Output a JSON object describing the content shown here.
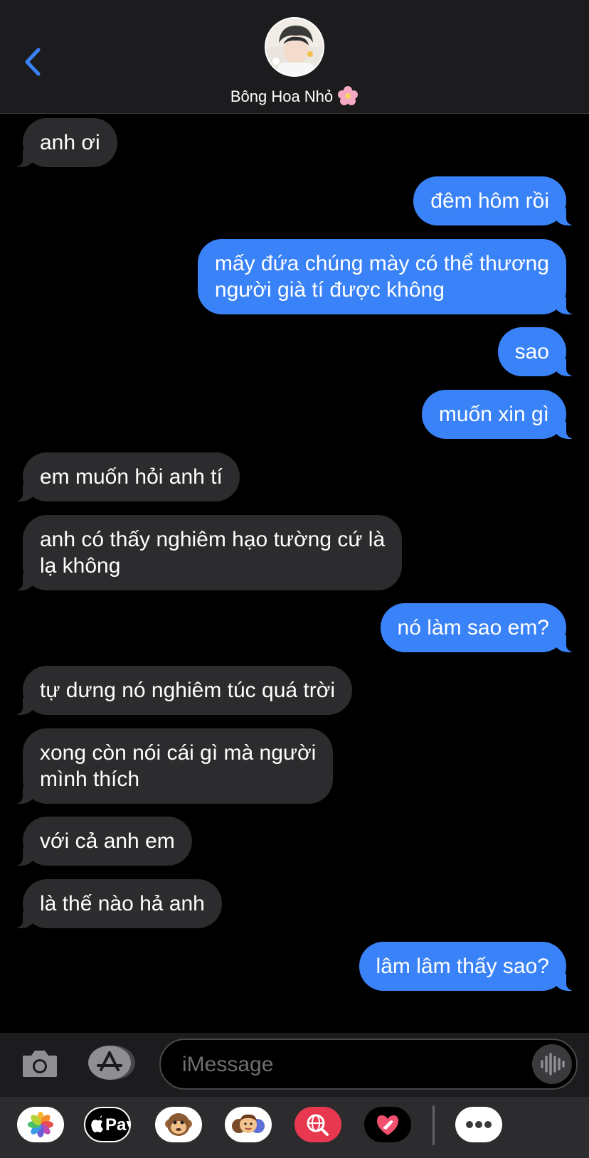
{
  "header": {
    "contact_name": "Bông Hoa Nhỏ",
    "back_icon": "chevron-left-icon",
    "accent_color": "#3a82f7"
  },
  "messages": [
    {
      "dir": "in",
      "lines": [
        "anh ơi"
      ]
    },
    {
      "dir": "out",
      "lines": [
        "đêm hôm rồi"
      ]
    },
    {
      "dir": "out",
      "lines": [
        "mấy đứa chúng mày có thể thương",
        "người già tí được không"
      ]
    },
    {
      "dir": "out",
      "lines": [
        "sao"
      ]
    },
    {
      "dir": "out",
      "lines": [
        "muốn xin gì"
      ]
    },
    {
      "dir": "in",
      "lines": [
        "em muốn hỏi anh tí"
      ]
    },
    {
      "dir": "in",
      "lines": [
        "anh có thấy nghiêm hạo tường cứ là",
        "lạ không"
      ]
    },
    {
      "dir": "out",
      "lines": [
        "nó làm sao em?"
      ]
    },
    {
      "dir": "in",
      "lines": [
        "tự dưng nó nghiêm túc quá trời"
      ]
    },
    {
      "dir": "in",
      "lines": [
        "xong còn nói cái gì mà người",
        "mình thích"
      ]
    },
    {
      "dir": "in",
      "lines": [
        "với cả anh em"
      ]
    },
    {
      "dir": "in",
      "lines": [
        "là thế nào hả anh"
      ]
    },
    {
      "dir": "out",
      "lines": [
        "lâm lâm thấy sao?"
      ]
    }
  ],
  "input": {
    "placeholder": "iMessage"
  },
  "app_drawer": {
    "apps": [
      "photos-app",
      "apple-pay-app",
      "animoji-app",
      "memoji-app",
      "web-search-app",
      "digital-touch-app",
      "more-apps"
    ],
    "apple_pay_label": "Pay"
  }
}
